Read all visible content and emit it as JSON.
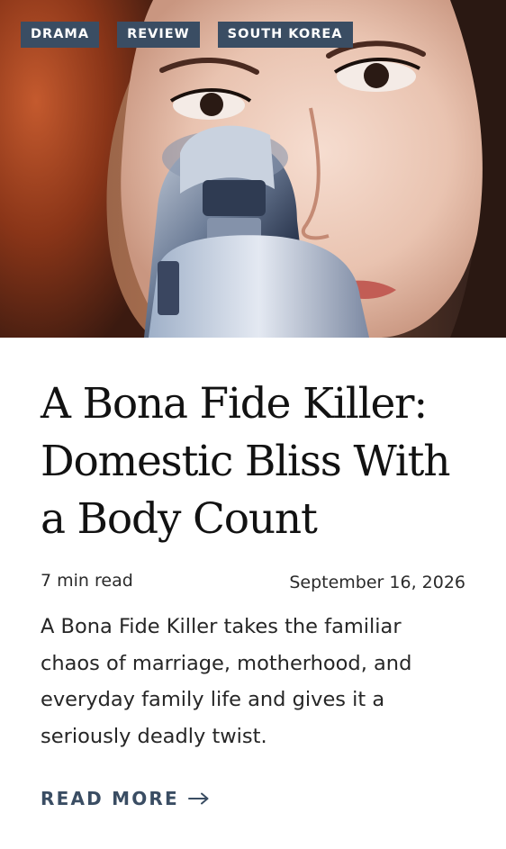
{
  "hero": {
    "tags": [
      "DRAMA",
      "REVIEW",
      "SOUTH KOREA"
    ]
  },
  "article": {
    "title": "A Bona Fide Killer: Domestic Bliss With a Body Count",
    "read_time": "7 min read",
    "date": "September 16, 2026",
    "excerpt": "A Bona Fide Killer takes the familiar chaos of marriage, motherhood, and everyday family life and gives it a seriously deadly twist.",
    "read_more": "READ MORE",
    "read_more_icon": "arrow-right-icon"
  },
  "colors": {
    "tag_background": "#3a4d63",
    "accent": "#3a4d63",
    "title": "#121212",
    "body_text": "#262626"
  }
}
